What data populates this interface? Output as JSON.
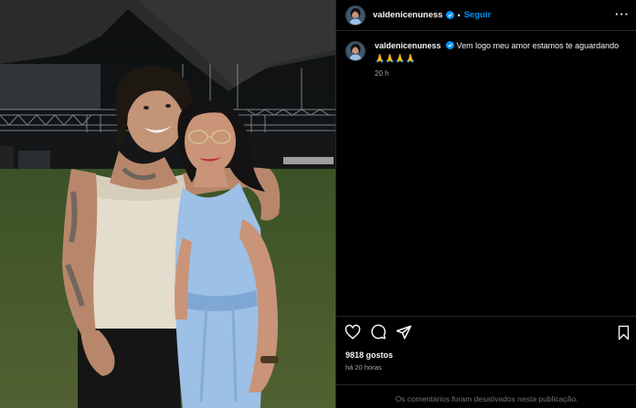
{
  "header": {
    "username": "valdenicenuness",
    "separator": "•",
    "follow_label": "Seguir",
    "more_label": "···"
  },
  "caption": {
    "username": "valdenicenuness",
    "text": "Vem logo meu amor estamos te aguardando",
    "emojis": "🙏🙏🙏🙏",
    "time": "20 h"
  },
  "actions": {
    "icons": [
      "heart-icon",
      "comment-icon",
      "share-icon",
      "bookmark-icon"
    ]
  },
  "stats": {
    "likes": "9818 gostos",
    "posted_ago": "há 20 horas"
  },
  "footer": {
    "comments_disabled": "Os comentários foram desativados nesta publicação."
  },
  "colors": {
    "background": "#000000",
    "accent": "#0095f6",
    "verified": "#0095f6",
    "muted": "#a8a8a8"
  }
}
